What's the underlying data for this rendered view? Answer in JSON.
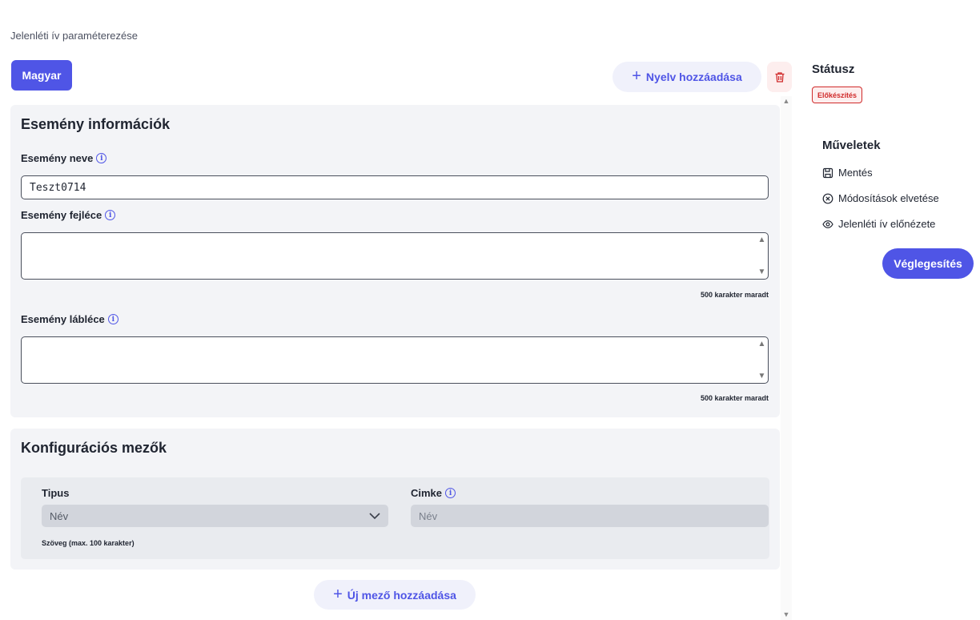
{
  "breadcrumb": "Jelenléti ív paraméterezése",
  "toolbar": {
    "language_tab": "Magyar",
    "add_language": "Nyelv hozzáadása"
  },
  "event_info": {
    "title": "Esemény információk",
    "name_label": "Esemény neve",
    "name_value": "Teszt0714",
    "header_label": "Esemény fejléce",
    "header_value": "",
    "header_remaining": "500 karakter maradt",
    "footer_label": "Esemény lábléce",
    "footer_value": "",
    "footer_remaining": "500 karakter maradt"
  },
  "config": {
    "title": "Konfigurációs mezők",
    "type_label": "Tipus",
    "type_selected": "Név",
    "label_label": "Cimke",
    "label_placeholder": "Név",
    "type_hint": "Szöveg (max. 100 karakter)",
    "add_field": "Új mező hozzáadása"
  },
  "sidebar": {
    "status_title": "Státusz",
    "status_badge": "Előkészítés",
    "status_color": "#d02a2a",
    "actions_title": "Műveletek",
    "actions": [
      {
        "label": "Mentés",
        "icon": "save-icon"
      },
      {
        "label": "Módosítások elvetése",
        "icon": "cancel-circle-icon"
      },
      {
        "label": "Jelenléti ív előnézete",
        "icon": "eye-icon"
      }
    ],
    "finalize": "Véglegesítés"
  },
  "colors": {
    "accent": "#4f55e6",
    "card_bg": "#f3f4f7",
    "danger": "#d02a2a"
  }
}
